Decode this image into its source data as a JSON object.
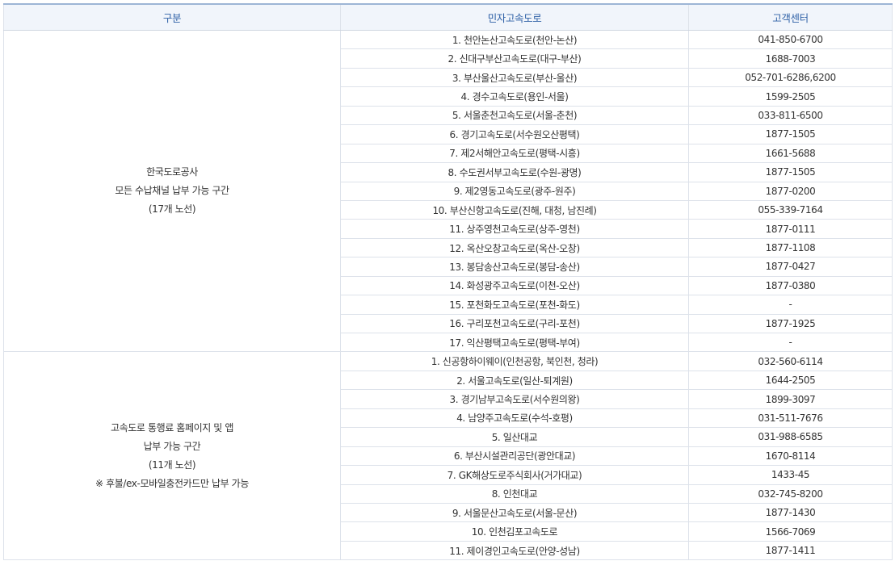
{
  "table": {
    "headers": [
      "구분",
      "민자고속도로",
      "고객센터"
    ],
    "groups": [
      {
        "label_lines": [
          "한국도로공사",
          "모든 수납채널 납부 가능 구간",
          "(17개 노선)"
        ],
        "rows": [
          {
            "road": "1. 천안논산고속도로(천안-논산)",
            "phone": "041-850-6700"
          },
          {
            "road": "2. 신대구부산고속도로(대구-부산)",
            "phone": "1688-7003"
          },
          {
            "road": "3. 부산울산고속도로(부산-울산)",
            "phone": "052-701-6286,6200"
          },
          {
            "road": "4. 경수고속도로(용인-서울)",
            "phone": "1599-2505"
          },
          {
            "road": "5. 서울춘천고속도로(서울-춘천)",
            "phone": "033-811-6500"
          },
          {
            "road": "6. 경기고속도로(서수원오산평택)",
            "phone": "1877-1505"
          },
          {
            "road": "7. 제2서해안고속도로(평택-시흥)",
            "phone": "1661-5688"
          },
          {
            "road": "8. 수도권서부고속도로(수원-광명)",
            "phone": "1877-1505"
          },
          {
            "road": "9. 제2영동고속도로(광주-원주)",
            "phone": "1877-0200"
          },
          {
            "road": "10. 부산신항고속도로(진해, 대청, 남진례)",
            "phone": "055-339-7164"
          },
          {
            "road": "11. 상주영천고속도로(상주-영천)",
            "phone": "1877-0111"
          },
          {
            "road": "12. 옥산오창고속도로(옥산-오창)",
            "phone": "1877-1108"
          },
          {
            "road": "13. 봉담송산고속도로(봉담-송산)",
            "phone": "1877-0427"
          },
          {
            "road": "14. 화성광주고속도로(이천-오산)",
            "phone": "1877-0380"
          },
          {
            "road": "15. 포천화도고속도로(포천-화도)",
            "phone": "-"
          },
          {
            "road": "16. 구리포천고속도로(구리-포천)",
            "phone": "1877-1925"
          },
          {
            "road": "17. 익산평택고속도로(평택-부여)",
            "phone": "-"
          }
        ]
      },
      {
        "label_lines": [
          "고속도로 통행료 홈페이지 및 앱",
          "납부 가능 구간",
          "(11개 노선)",
          "※ 후불/ex-모바일충전카드만 납부 가능"
        ],
        "rows": [
          {
            "road": "1. 신공항하이웨이(인천공항, 북인천, 청라)",
            "phone": "032-560-6114"
          },
          {
            "road": "2. 서울고속도로(일산-퇴계원)",
            "phone": "1644-2505"
          },
          {
            "road": "3. 경기남부고속도로(서수원의왕)",
            "phone": "1899-3097"
          },
          {
            "road": "4. 남양주고속도로(수석-호평)",
            "phone": "031-511-7676"
          },
          {
            "road": "5. 일산대교",
            "phone": "031-988-6585"
          },
          {
            "road": "6. 부산시설관리공단(광안대교)",
            "phone": "1670-8114"
          },
          {
            "road": "7. GK해상도로주식회사(거가대교)",
            "phone": "1433-45"
          },
          {
            "road": "8. 인천대교",
            "phone": "032-745-8200"
          },
          {
            "road": "9. 서울문산고속도로(서울-문산)",
            "phone": "1877-1430"
          },
          {
            "road": "10. 인천김포고속도로",
            "phone": "1566-7069"
          },
          {
            "road": "11. 제이경인고속도로(안양-성남)",
            "phone": "1877-1411"
          }
        ]
      }
    ]
  },
  "colors": {
    "header_bg": "#f1f5fb",
    "header_text": "#2f61a7",
    "header_top_border": "#9db5d5",
    "cell_border": "#dde2ea",
    "body_text": "#333333"
  }
}
